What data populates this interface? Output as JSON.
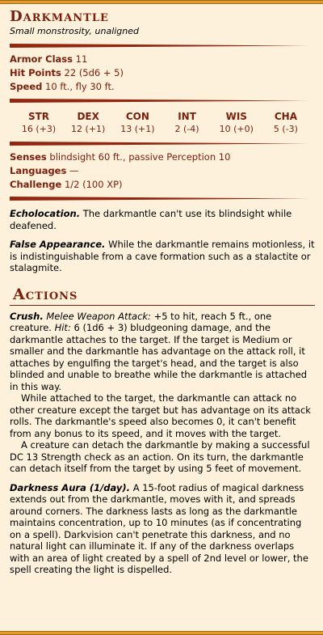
{
  "colors": {
    "accent": "#7a200d",
    "background": "#fdf1dc",
    "edge": "#e69a28"
  },
  "name": "Darkmantle",
  "subtitle": "Small monstrosity, unaligned",
  "armor_class": {
    "label": "Armor Class",
    "value": "11"
  },
  "hit_points": {
    "label": "Hit Points",
    "value": "22 (5d6 + 5)"
  },
  "speed": {
    "label": "Speed",
    "value": "10 ft., fly 30 ft."
  },
  "abilities": [
    {
      "key": "STR",
      "value": "16 (+3)"
    },
    {
      "key": "DEX",
      "value": "12 (+1)"
    },
    {
      "key": "CON",
      "value": "13 (+1)"
    },
    {
      "key": "INT",
      "value": "2 (-4)"
    },
    {
      "key": "WIS",
      "value": "10 (+0)"
    },
    {
      "key": "CHA",
      "value": "5 (-3)"
    }
  ],
  "senses": {
    "label": "Senses",
    "value": "blindsight 60 ft., passive Perception 10"
  },
  "languages": {
    "label": "Languages",
    "value": "—"
  },
  "challenge": {
    "label": "Challenge",
    "value": "1/2 (100 XP)"
  },
  "traits": [
    {
      "title": "Echolocation.",
      "text": "The darkmantle can't use its blindsight while deafened."
    },
    {
      "title": "False Appearance.",
      "text": "While the darkmantle remains motionless, it is indistinguishable from a cave formation such as a stalactite or stalagmite."
    }
  ],
  "actions_title": "Actions",
  "crush": {
    "title": "Crush.",
    "attack_type": "Melee Weapon Attack:",
    "attack_text": "+5 to hit, reach 5 ft., one creature.",
    "hit_label": "Hit:",
    "hit_text": "6 (1d6 + 3) bludgeoning damage, and the darkmantle attaches to the target. If the target is Medium or smaller and the darkmantle has advantage on the attack roll, it attaches by engulfing the target's head, and the target is also blinded and unable to breathe while the darkmantle is attached in this way.",
    "para2": "While attached to the target, the darkmantle can attack no other creature except the target but has advantage on its attack rolls. The darkmantle's speed also becomes 0, it can't benefit from any bonus to its speed, and it moves with the target.",
    "para3": "A creature can detach the darkmantle by making a successful DC 13 Strength check as an action. On its turn, the darkmantle can detach itself from the target by using 5 feet of movement."
  },
  "darkness_aura": {
    "title": "Darkness Aura (1/day).",
    "text": "A 15-foot radius of magical darkness extends out from the darkmantle, moves with it, and spreads around corners. The darkness lasts as long as the darkmantle maintains concentration, up to 10 minutes (as if concentrating on a spell). Darkvision can't penetrate this darkness, and no natural light can illuminate it. If any of the darkness overlaps with an area of light created by a spell of 2nd level or lower, the spell creating the light is dispelled."
  }
}
